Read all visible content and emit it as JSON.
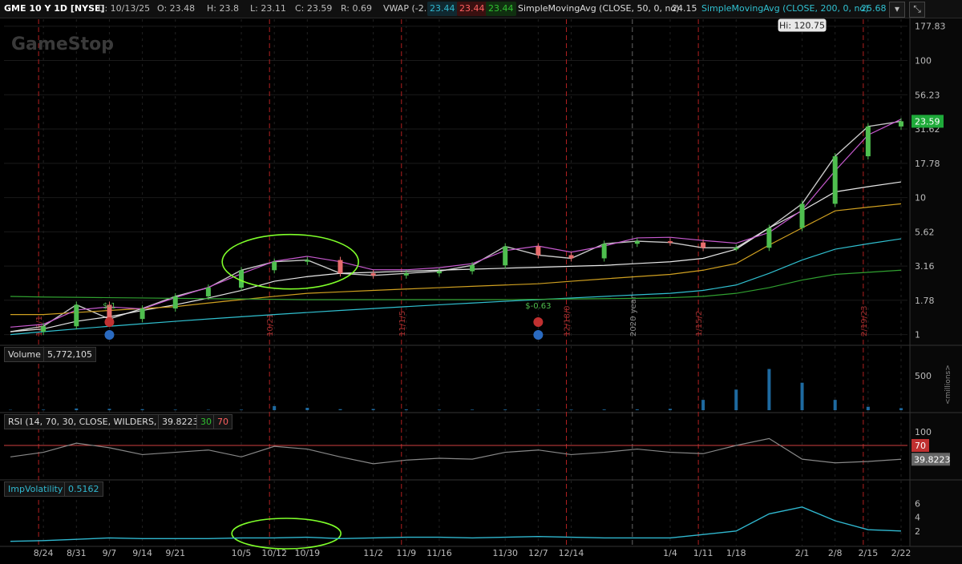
{
  "header": {
    "symbol": "GME 10 Y 1D [NYSE]",
    "ohlc": {
      "date": "D: 10/13/25",
      "open": "O: 23.48",
      "high": "H: 23.8",
      "low": "L: 23.11",
      "close": "C: 23.59",
      "range": "R: 0.69"
    },
    "vwap": {
      "label": "VWAP (-2.0, 2.0, DAY)",
      "values": [
        "23.44",
        "23.44",
        "23.44"
      ]
    },
    "sma50": {
      "label": "SimpleMovingAvg (CLOSE, 50, 0, no)",
      "value": "24.15"
    },
    "sma200": {
      "label": "SimpleMovingAvg (CLOSE, 200, 0, no)",
      "value": "25.68"
    }
  },
  "watermark": "GameStop",
  "panels": {
    "volume": {
      "label": "Volume",
      "value": "5,772,105",
      "unit": "<millions>"
    },
    "rsi": {
      "label": "RSI (14, 70, 30, CLOSE, WILDERS, no)",
      "value": "39.8223",
      "over_sold": "30",
      "over_bought": "70"
    },
    "iv": {
      "label": "ImpVolatility",
      "value": "0.5162"
    }
  },
  "colors": {
    "bg": "#000000",
    "up": "#4fbf4f",
    "down": "#e86c6c",
    "price_line": "#c8c8c8",
    "vwap_pink": "#c85ad0",
    "sma50": "#d0a020",
    "sma200": "#30c0d0",
    "sma_white": "#e8e8e8",
    "sma_green": "#30a030",
    "rsi_line": "#888888",
    "iv_line": "#30b8d0",
    "annotation": "#7fff2a",
    "cursor": "#b02020"
  },
  "chart_data": [
    {
      "type": "line",
      "title": "",
      "scale": "log",
      "y_ticks": [
        "1",
        "1.78",
        "3.16",
        "5.62",
        "10",
        "17.78",
        "31.62",
        "56.23",
        "100",
        "177.83"
      ],
      "ylim": [
        0.87,
        200
      ],
      "x_ticks": [
        "8/24",
        "8/31",
        "9/7",
        "9/14",
        "9/21",
        "10/5",
        "10/12",
        "10/19",
        "11/2",
        "11/9",
        "11/16",
        "11/30",
        "12/7",
        "12/14",
        "1/4",
        "1/11",
        "1/18",
        "2/1",
        "2/8",
        "2/15",
        "2/22"
      ],
      "x": [
        "8/17",
        "8/24",
        "8/31",
        "9/7",
        "9/14",
        "9/21",
        "9/28",
        "10/5",
        "10/12",
        "10/19",
        "10/26",
        "11/2",
        "11/9",
        "11/16",
        "11/23",
        "11/30",
        "12/7",
        "12/14",
        "12/21",
        "12/28",
        "1/4",
        "1/11",
        "1/18",
        "1/25",
        "2/1",
        "2/8",
        "2/15",
        "2/22"
      ],
      "series": [
        {
          "values": [
            1.05,
            1.15,
            1.65,
            1.3,
            1.55,
            1.9,
            2.2,
            2.95,
            3.4,
            3.5,
            2.8,
            2.7,
            2.8,
            2.9,
            3.2,
            4.4,
            3.8,
            3.6,
            4.6,
            4.8,
            4.7,
            4.3,
            4.3,
            6,
            9,
            20,
            33,
            36
          ]
        },
        {
          "values": [
            1.05,
            1.1,
            1.25,
            1.35,
            1.5,
            1.65,
            1.85,
            2.1,
            2.45,
            2.65,
            2.8,
            2.85,
            2.9,
            2.95,
            3.0,
            3.05,
            3.1,
            3.15,
            3.2,
            3.3,
            3.4,
            3.6,
            4.2,
            6,
            8,
            11,
            12,
            13
          ]
        },
        {
          "values": [
            1.4,
            1.4,
            1.45,
            1.5,
            1.55,
            1.6,
            1.7,
            1.8,
            1.9,
            2.0,
            2.05,
            2.1,
            2.15,
            2.2,
            2.25,
            2.3,
            2.35,
            2.45,
            2.55,
            2.65,
            2.75,
            2.95,
            3.3,
            4.5,
            6,
            8,
            8.5,
            9
          ]
        },
        {
          "values": [
            1.0,
            1.05,
            1.1,
            1.15,
            1.2,
            1.25,
            1.3,
            1.35,
            1.4,
            1.45,
            1.5,
            1.55,
            1.6,
            1.65,
            1.7,
            1.75,
            1.8,
            1.85,
            1.9,
            1.95,
            2.0,
            2.1,
            2.3,
            2.8,
            3.5,
            4.2,
            4.6,
            5
          ]
        },
        {
          "values": [
            1.9,
            1.88,
            1.87,
            1.86,
            1.85,
            1.84,
            1.83,
            1.82,
            1.81,
            1.8,
            1.8,
            1.8,
            1.8,
            1.8,
            1.8,
            1.8,
            1.81,
            1.82,
            1.83,
            1.84,
            1.86,
            1.9,
            2.0,
            2.2,
            2.5,
            2.75,
            2.85,
            2.95
          ]
        }
      ],
      "price_label": "23.59",
      "high_label": "Hi: 120.75",
      "annotations": [
        {
          "text": "$-1",
          "x": "9/7",
          "y": 1.55
        },
        {
          "text": "$-0.63",
          "x": "12/7",
          "y": 1.55
        }
      ],
      "event_labels": [
        {
          "text": "1/2/1",
          "x": "8/24"
        },
        {
          "text": "10/21",
          "x": "10/12"
        },
        {
          "text": "11/1/5",
          "x": "11/9"
        },
        {
          "text": "12/18/0",
          "x": "12/14"
        },
        {
          "text": "2020 year",
          "x": "12/28"
        },
        {
          "text": "1/15/2",
          "x": "1/11"
        },
        {
          "text": "2/19/23",
          "x": "2/15"
        }
      ],
      "markers": [
        {
          "x": "9/7"
        },
        {
          "x": "12/7"
        }
      ]
    },
    {
      "type": "bar",
      "title": "Volume",
      "y_ticks": [
        "500"
      ],
      "ylim": [
        0,
        700
      ],
      "values": [
        5,
        8,
        25,
        20,
        15,
        8,
        6,
        8,
        60,
        35,
        15,
        18,
        12,
        8,
        8,
        10,
        8,
        8,
        10,
        12,
        20,
        150,
        300,
        600,
        400,
        150,
        50,
        30
      ]
    },
    {
      "type": "line",
      "title": "RSI",
      "y_ticks": [
        "100",
        "70"
      ],
      "ylim": [
        0,
        105
      ],
      "values": [
        45,
        55,
        75,
        65,
        50,
        55,
        60,
        45,
        68,
        62,
        45,
        30,
        38,
        42,
        40,
        55,
        60,
        50,
        55,
        62,
        55,
        52,
        70,
        85,
        40,
        32,
        35,
        39.8
      ]
    },
    {
      "type": "line",
      "title": "ImpVolatility",
      "y_ticks": [
        "6",
        "4",
        "2"
      ],
      "ylim": [
        0,
        7
      ],
      "values": [
        0.5,
        0.6,
        0.8,
        1.0,
        0.9,
        0.9,
        0.9,
        1.0,
        1.0,
        1.1,
        0.9,
        1.0,
        1.1,
        1.1,
        1.0,
        1.1,
        1.2,
        1.1,
        1.0,
        1.0,
        1.0,
        1.5,
        2.0,
        4.5,
        5.5,
        3.5,
        2.2,
        2.0
      ]
    }
  ]
}
